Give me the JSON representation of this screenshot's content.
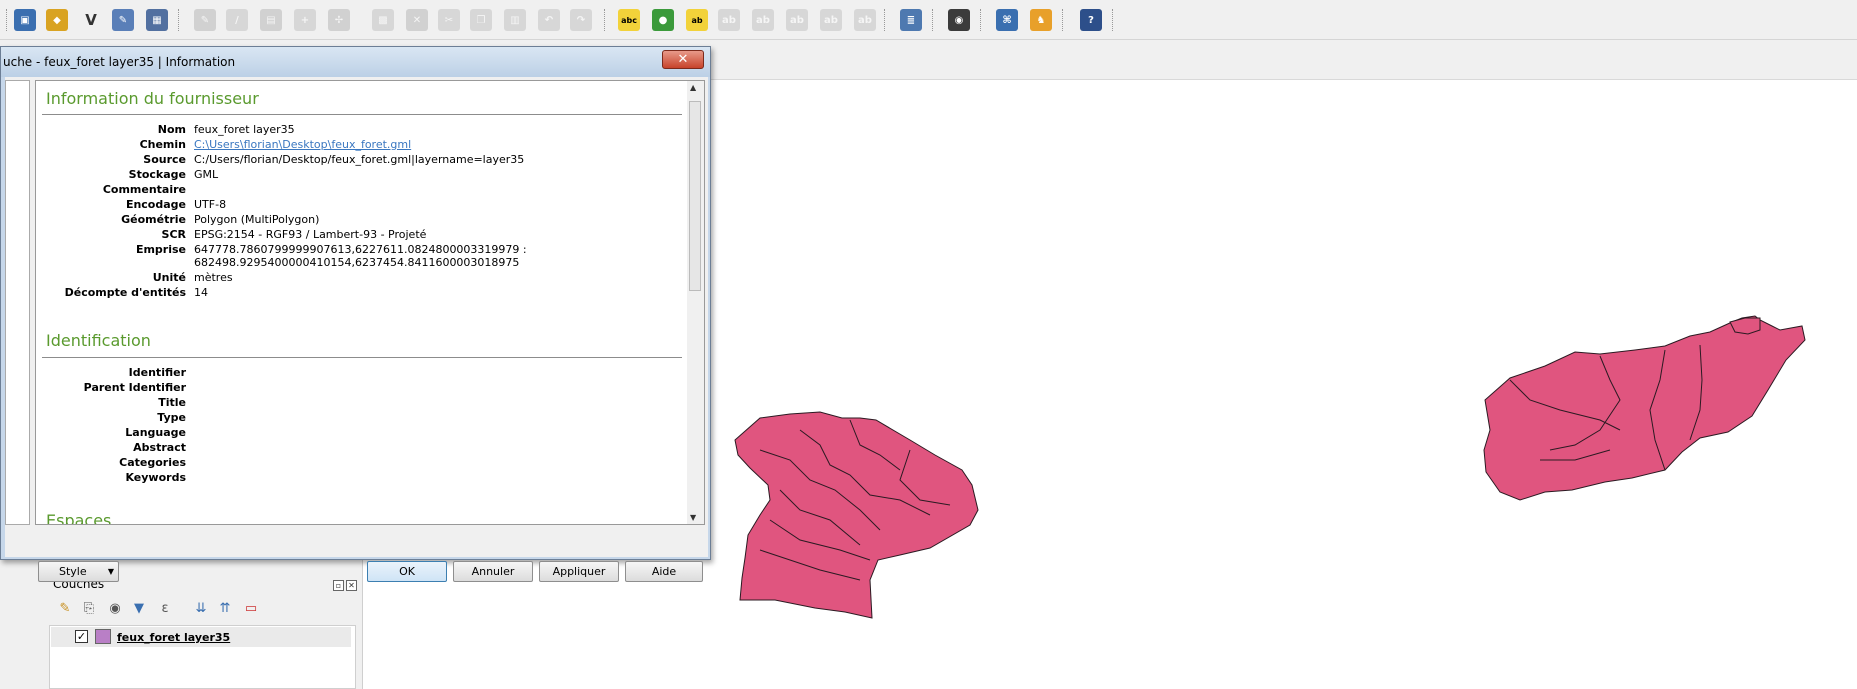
{
  "dialog": {
    "title": "uche - feux_foret layer35 | Information",
    "close_label": "✕",
    "sections": {
      "provider": {
        "title": "Information du fournisseur",
        "rows": [
          {
            "label": "Nom",
            "value": "feux_foret layer35"
          },
          {
            "label": "Chemin",
            "value": "C:\\Users\\florian\\Desktop\\feux_foret.gml"
          },
          {
            "label": "Source",
            "value": "C:/Users/florian/Desktop/feux_foret.gml|layername=layer35"
          },
          {
            "label": "Stockage",
            "value": "GML"
          },
          {
            "label": "Commentaire",
            "value": ""
          },
          {
            "label": "Encodage",
            "value": "UTF-8"
          },
          {
            "label": "Géométrie",
            "value": "Polygon (MultiPolygon)"
          },
          {
            "label": "SCR",
            "value": "EPSG:2154 - RGF93 / Lambert-93 - Projeté"
          },
          {
            "label": "Emprise",
            "value": "647778.7860799999907613,6227611.0824800003319979 :",
            "value2": "682498.9295400000410154,6237454.8411600003018975"
          },
          {
            "label": "Unité",
            "value": "mètres"
          },
          {
            "label": "Décompte d'entités",
            "value": "14"
          }
        ]
      },
      "identification": {
        "title": "Identification",
        "rows": [
          "Identifier",
          "Parent Identifier",
          "Title",
          "Type",
          "Language",
          "Abstract",
          "Categories",
          "Keywords"
        ]
      },
      "next_partial": "Espaces"
    },
    "buttons": {
      "style": "Style",
      "ok": "OK",
      "cancel": "Annuler",
      "apply": "Appliquer",
      "help": "Aide"
    }
  },
  "layers_panel": {
    "title": "Couches",
    "layer": {
      "name": "feux_foret layer35",
      "checked": "✓",
      "color": "#b97fc6"
    }
  },
  "map": {
    "fill": "#e0557f",
    "stroke": "#2b1a22"
  },
  "toolbar": {
    "icons": [
      "open-project-icon",
      "new-layer-icon",
      "vertex-icon",
      "digitize-icon",
      "gps-icon",
      "pencil-icon",
      "edit-icon",
      "save-edits-icon",
      "add-feature-icon",
      "move-feature-icon",
      "node-tool-icon",
      "delete-icon",
      "cut-icon",
      "copy-icon",
      "paste-icon",
      "undo-icon",
      "redo-icon",
      "label-icon",
      "style-icon",
      "label-pin-icon",
      "label-show-icon",
      "label-move-icon",
      "label-rotate-icon",
      "label-change-icon",
      "database-icon",
      "globe-icon",
      "python-icon",
      "plugin-icon",
      "help-icon"
    ],
    "label_text": "abc"
  }
}
